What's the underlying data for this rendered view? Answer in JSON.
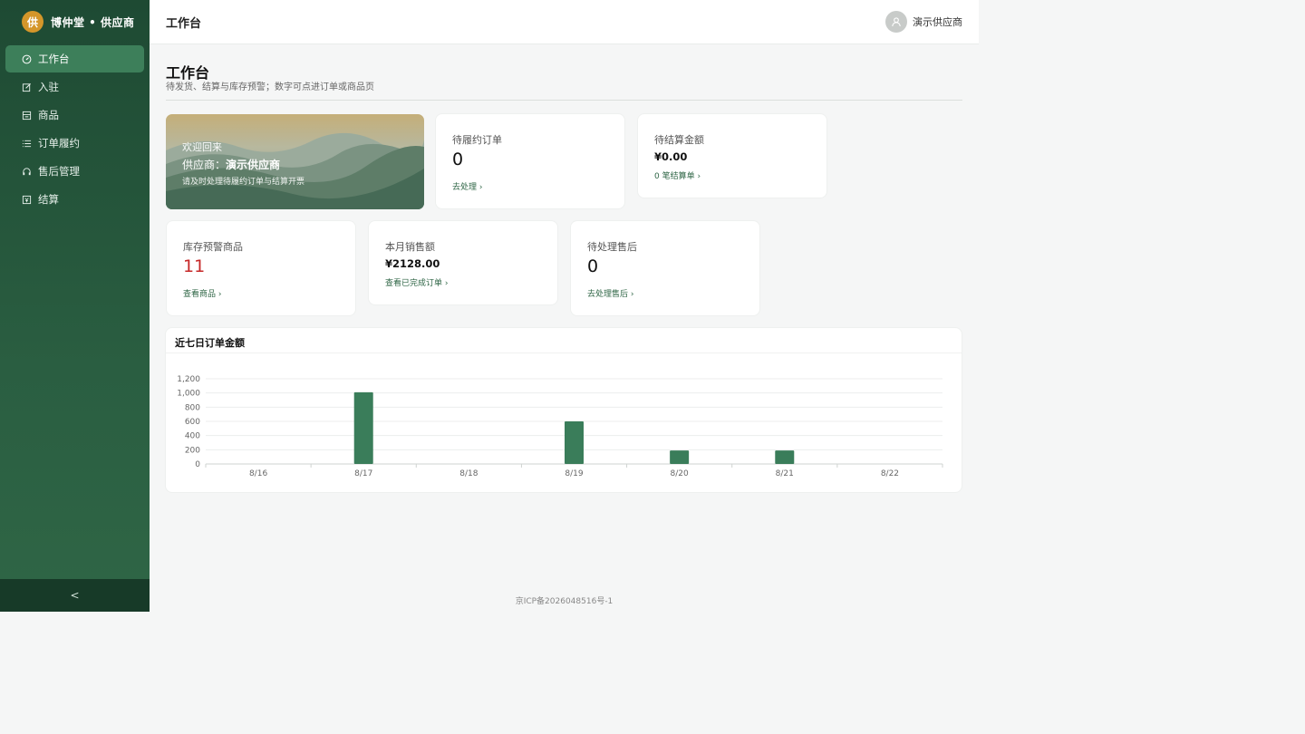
{
  "brand": {
    "logo_char": "供",
    "name": "博仲堂 • 供应商"
  },
  "sidebar": {
    "items": [
      {
        "label": "工作台",
        "icon": "dashboard-icon",
        "active": true
      },
      {
        "label": "入驻",
        "icon": "edit-icon"
      },
      {
        "label": "商品",
        "icon": "goods-icon"
      },
      {
        "label": "订单履约",
        "icon": "list-icon"
      },
      {
        "label": "售后管理",
        "icon": "headset-icon"
      },
      {
        "label": "结算",
        "icon": "settle-icon"
      }
    ],
    "collapse_label": "<"
  },
  "header": {
    "title": "工作台",
    "user_name": "演示供应商"
  },
  "page": {
    "title": "工作台",
    "subtitle": "待发货、结算与库存预警；数字可点进订单或商品页"
  },
  "banner": {
    "greeting": "欢迎回来",
    "supplier_prefix": "供应商：",
    "supplier_name": "演示供应商",
    "hint": "请及时处理待履约订单与结算开票"
  },
  "cards": {
    "pending_orders": {
      "label": "待履约订单",
      "value": "0",
      "link": "去处理 ›"
    },
    "pending_settlement": {
      "label": "待结算金额",
      "value": "¥0.00",
      "link": "0 笔结算单 ›"
    },
    "stock_alert": {
      "label": "库存预警商品",
      "value": "11",
      "link": "查看商品 ›"
    },
    "monthly_sales": {
      "label": "本月销售额",
      "value": "¥2128.00",
      "link": "查看已完成订单 ›"
    },
    "pending_aftersale": {
      "label": "待处理售后",
      "value": "0",
      "link": "去处理售后 ›"
    }
  },
  "chart_data": {
    "type": "bar",
    "title": "近七日订单金额",
    "categories": [
      "8/16",
      "8/17",
      "8/18",
      "8/19",
      "8/20",
      "8/21",
      "8/22"
    ],
    "values": [
      0,
      1010,
      0,
      600,
      190,
      190,
      0
    ],
    "ylim": [
      0,
      1200
    ],
    "yticks": [
      "0",
      "200",
      "400",
      "600",
      "800",
      "1,000",
      "1,200"
    ],
    "grid": true,
    "bar_color": "#3a7d5a"
  },
  "footer": {
    "icp": "京ICP备2026048516号-1"
  }
}
